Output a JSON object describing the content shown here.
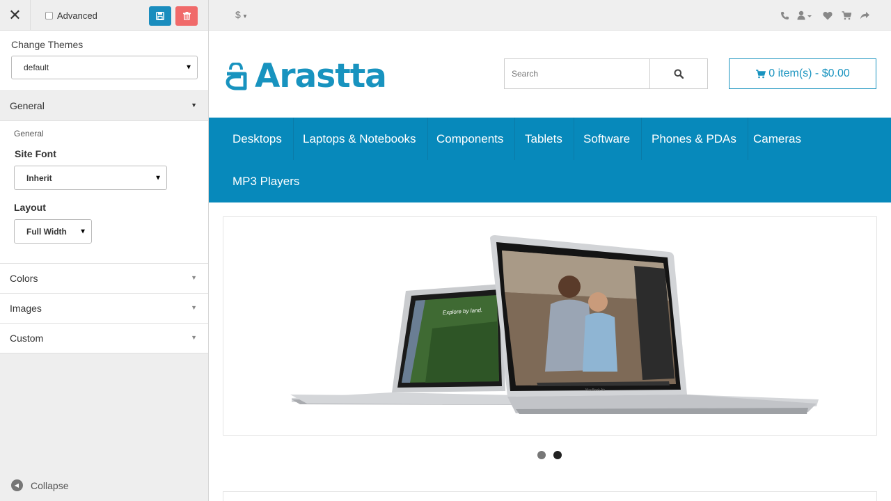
{
  "panel": {
    "advanced_label": "Advanced",
    "change_themes_title": "Change Themes",
    "theme_selected": "default",
    "sections": {
      "general": "General",
      "colors": "Colors",
      "images": "Images",
      "custom": "Custom"
    },
    "general_body": {
      "subtitle": "General",
      "site_font_label": "Site Font",
      "site_font_value": "Inherit",
      "layout_label": "Layout",
      "layout_value": "Full Width"
    },
    "collapse_label": "Collapse",
    "colors": {
      "save": "#1a8dbe",
      "delete": "#f06a6a"
    }
  },
  "topbar": {
    "currency_symbol": "$",
    "icons": [
      "phone-icon",
      "user-icon",
      "heart-icon",
      "cart-icon",
      "share-icon"
    ]
  },
  "header": {
    "logo_text": "Arastta",
    "search_placeholder": "Search",
    "cart_label": "0 item(s) - $0.00",
    "brand_color": "#1893bf"
  },
  "menu": {
    "items": [
      "Desktops",
      "Laptops & Notebooks",
      "Components",
      "Tablets",
      "Software",
      "Phones & PDAs",
      "Cameras",
      "MP3 Players"
    ],
    "background": "#0789bb"
  },
  "banner": {
    "laptop_small_text": "Explore by land.",
    "laptop_brand": "MacBook Air",
    "slides_total": 2,
    "active_slide": 2
  }
}
